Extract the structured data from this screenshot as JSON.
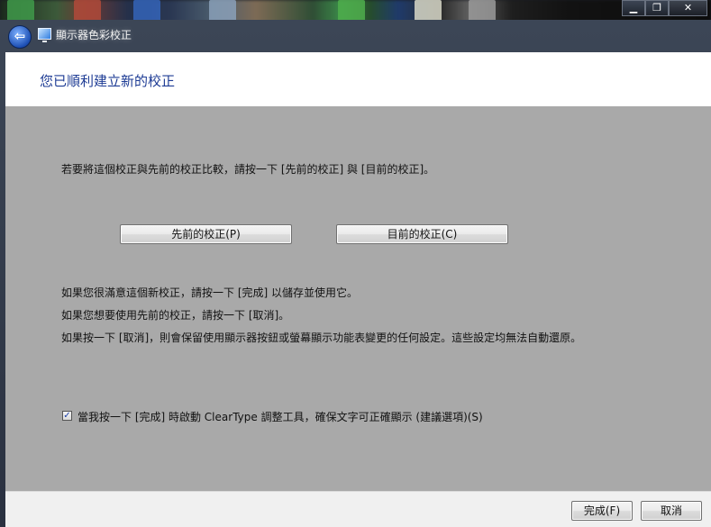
{
  "window": {
    "title": "顯示器色彩校正",
    "controls": {
      "minimize": "▁",
      "maximize": "❐",
      "close": "✕"
    },
    "back_glyph": "⇦"
  },
  "page": {
    "heading": "您已順利建立新的校正",
    "compare_text": "若要將這個校正與先前的校正比較，請按一下 [先前的校正] 與 [目前的校正]。",
    "previous_button": "先前的校正(P)",
    "current_button": "目前的校正(C)",
    "info_line1": "如果您很滿意這個新校正，請按一下 [完成] 以儲存並使用它。",
    "info_line2": "如果您想要使用先前的校正，請按一下 [取消]。",
    "info_line3": "如果按一下 [取消]，則會保留使用顯示器按鈕或螢幕顯示功能表變更的任何設定。這些設定均無法自動還原。",
    "cleartype_checkbox": {
      "checked": true,
      "mark": "✓",
      "label": "當我按一下 [完成] 時啟動 ClearType 調整工具，確保文字可正確顯示 (建議選項)(S)"
    }
  },
  "footer": {
    "finish_button": "完成(F)",
    "cancel_button": "取消"
  },
  "colors": {
    "heading": "#1d3b94",
    "content_bg": "#a9a9a9",
    "header_bg": "#ffffff",
    "footer_bg": "#f0f0f0"
  }
}
